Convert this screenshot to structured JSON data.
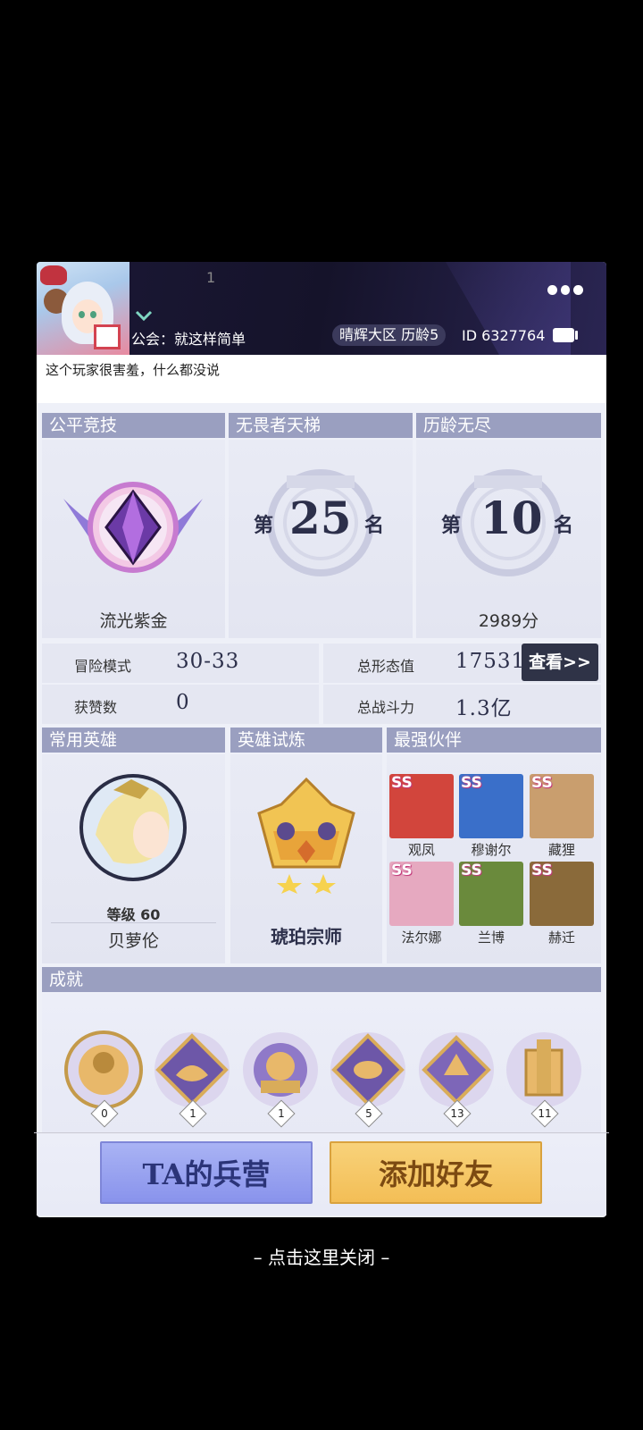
{
  "header": {
    "rank_number": "1",
    "guild_label": "公会：就这样简单",
    "server_tag": "晴辉大区  历龄5",
    "player_id": "ID 6327764"
  },
  "bio": "这个玩家很害羞，什么都没说",
  "sections": {
    "fair_competition": {
      "title": "公平竞技",
      "rank_name": "流光紫金"
    },
    "ladder": {
      "title": "无畏者天梯",
      "prefix": "第",
      "place": "25",
      "suffix": "名"
    },
    "endless": {
      "title": "历龄无尽",
      "prefix": "第",
      "place": "10",
      "suffix": "名",
      "score": "2989分"
    }
  },
  "stats": {
    "adventure_label": "冒险模式",
    "adventure_value": "30-33",
    "likes_label": "获赞数",
    "likes_value": "0",
    "form_label": "总形态值",
    "form_value": "17531",
    "power_label": "总战斗力",
    "power_value": "1.3亿",
    "view_button": "查看>>"
  },
  "common_hero": {
    "title": "常用英雄",
    "level": "等级 60",
    "name": "贝萝伦"
  },
  "hero_trial": {
    "title": "英雄试炼",
    "rank": "琥珀宗师"
  },
  "partners": {
    "title": "最强伙伴",
    "items": [
      {
        "grade": "SS",
        "name": "观凤",
        "color": "#d2453c"
      },
      {
        "grade": "SS",
        "name": "穆谢尔",
        "color": "#3a6fc9"
      },
      {
        "grade": "SS",
        "name": "藏狸",
        "color": "#c99e6e"
      },
      {
        "grade": "SS",
        "name": "法尔娜",
        "color": "#e6a9c0"
      },
      {
        "grade": "SS",
        "name": "兰博",
        "color": "#6a8a3c"
      },
      {
        "grade": "SS",
        "name": "赫迁",
        "color": "#8a6a3a"
      }
    ]
  },
  "achievements": {
    "title": "成就",
    "counts": [
      "0",
      "1",
      "1",
      "5",
      "13",
      "11"
    ]
  },
  "buttons": {
    "barracks": "TA的兵营",
    "add_friend": "添加好友"
  },
  "close_hint": "– 点击这里关闭 –"
}
